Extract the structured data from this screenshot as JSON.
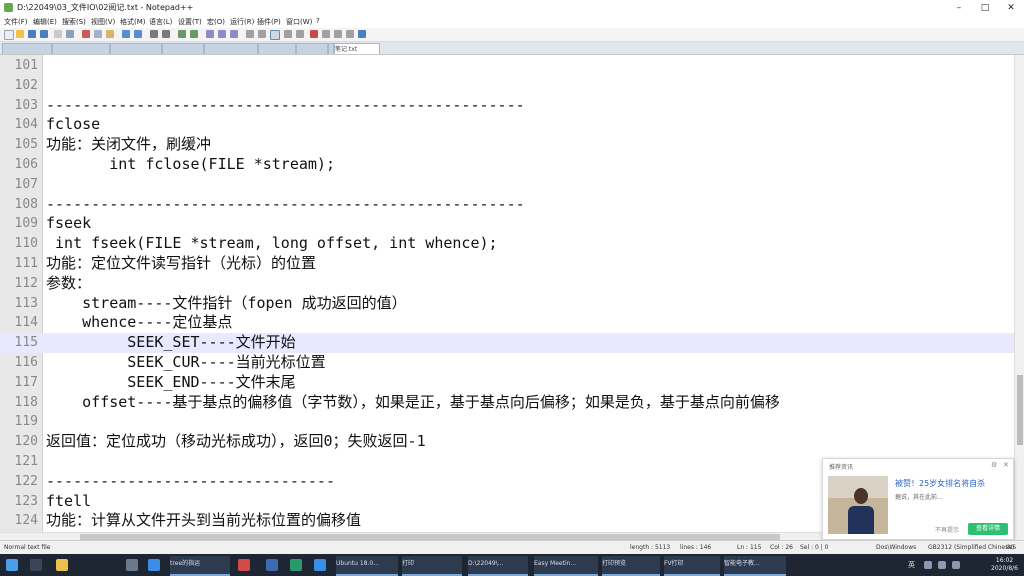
{
  "window": {
    "title": "D:\\22049\\03_文件IO\\02阅记.txt - Notepad++",
    "minimize": "–",
    "maximize": "□",
    "close": "✕"
  },
  "menu": [
    "文件(F)",
    "编辑(E)",
    "搜索(S)",
    "视图(V)",
    "格式(M)",
    "语言(L)",
    "设置(T)",
    "宏(O)",
    "运行(R)",
    "插件(P)",
    "窗口(W)",
    "?"
  ],
  "tabs": [
    "",
    "",
    "",
    "",
    "",
    "",
    "",
    "",
    "笔记.txt"
  ],
  "editor": {
    "lines": [
      {
        "num": "101",
        "text": ""
      },
      {
        "num": "102",
        "text": ""
      },
      {
        "num": "103",
        "text": "-----------------------------------------------------"
      },
      {
        "num": "104",
        "text": "fclose"
      },
      {
        "num": "105",
        "text": "功能：关闭文件，刷缓冲"
      },
      {
        "num": "106",
        "text": "       int fclose(FILE *stream);"
      },
      {
        "num": "107",
        "text": ""
      },
      {
        "num": "108",
        "text": "-----------------------------------------------------"
      },
      {
        "num": "109",
        "text": "fseek"
      },
      {
        "num": "110",
        "text": " int fseek(FILE *stream, long offset, int whence);"
      },
      {
        "num": "111",
        "text": "功能：定位文件读写指针（光标）的位置"
      },
      {
        "num": "112",
        "text": "参数："
      },
      {
        "num": "113",
        "text": "    stream----文件指针（fopen 成功返回的值）"
      },
      {
        "num": "114",
        "text": "    whence----定位基点"
      },
      {
        "num": "115",
        "text": "         SEEK_SET----文件开始"
      },
      {
        "num": "116",
        "text": "         SEEK_CUR----当前光标位置"
      },
      {
        "num": "117",
        "text": "         SEEK_END----文件末尾"
      },
      {
        "num": "118",
        "text": "    offset----基于基点的偏移值（字节数），如果是正，基于基点向后偏移；如果是负，基于基点向前偏移"
      },
      {
        "num": "119",
        "text": ""
      },
      {
        "num": "120",
        "text": "返回值：定位成功（移动光标成功），返回0；失败返回-1"
      },
      {
        "num": "121",
        "text": ""
      },
      {
        "num": "122",
        "text": "--------------------------------"
      },
      {
        "num": "123",
        "text": "ftell"
      },
      {
        "num": "124",
        "text": "功能：计算从文件开头到当前光标位置的偏移值"
      }
    ]
  },
  "status": {
    "type": "Normal text file",
    "length": "length : 5113",
    "lines": "lines : 146",
    "ln": "Ln : 115",
    "col": "Col : 26",
    "sel": "Sel : 0 | 0",
    "eol": "Dos\\Windows",
    "encoding": "GB2312 (Simplified Chinese)",
    "mode": "INS"
  },
  "taskbar": {
    "tasks": [
      "tree的指运",
      "Ubuntu 18.0...",
      "打印",
      "D:\\22049\\...",
      "Easy Meetin...",
      "打印预览",
      "FV打印",
      "智能电子教..."
    ],
    "time": "16:02",
    "date": "2020/8/6",
    "ime": "英"
  },
  "popup": {
    "header": "推荐资讯",
    "headline": "被赞！25岁女排名将自杀",
    "sub": "据说，其在此前...",
    "link": "不再提示",
    "button": "查看详情"
  },
  "colors": {
    "current_line": "#e8e8ff",
    "gutter": "#e8e8e8",
    "taskbar": "#1f2633",
    "popup_title": "#2a60c8",
    "popup_button": "#2fbf71"
  },
  "icons": [
    "app-icon",
    "new-file-icon",
    "open-file-icon",
    "save-icon",
    "undo-icon",
    "redo-icon",
    "search-icon",
    "windows-start-icon",
    "search-taskbar-icon"
  ]
}
